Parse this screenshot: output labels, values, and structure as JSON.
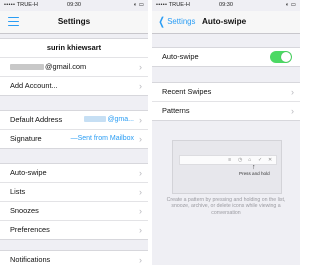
{
  "left": {
    "status": {
      "carrier": "TRUE-H",
      "time": "09:30"
    },
    "nav_title": "Settings",
    "account_name": "surin khiewsart",
    "email_suffix": "@gmail.com",
    "add_account": "Add Account...",
    "default_address_label": "Default Address",
    "default_address_value_suffix": "@gma...",
    "signature_label": "Signature",
    "signature_value": "—Sent from Mailbox",
    "menu": [
      "Auto-swipe",
      "Lists",
      "Snoozes",
      "Preferences"
    ],
    "notifications": "Notifications"
  },
  "right": {
    "status": {
      "carrier": "TRUE-H",
      "time": "09:30"
    },
    "back_label": "Settings",
    "nav_title": "Auto-swipe",
    "autoswipe_label": "Auto-swipe",
    "autoswipe_on": true,
    "recent_swipes": "Recent Swipes",
    "patterns": "Patterns",
    "press_hold": "Press and hold",
    "description": "Create a pattern by pressing and holding on the list, snooze, archive, or delete icons while viewing a conversation"
  }
}
